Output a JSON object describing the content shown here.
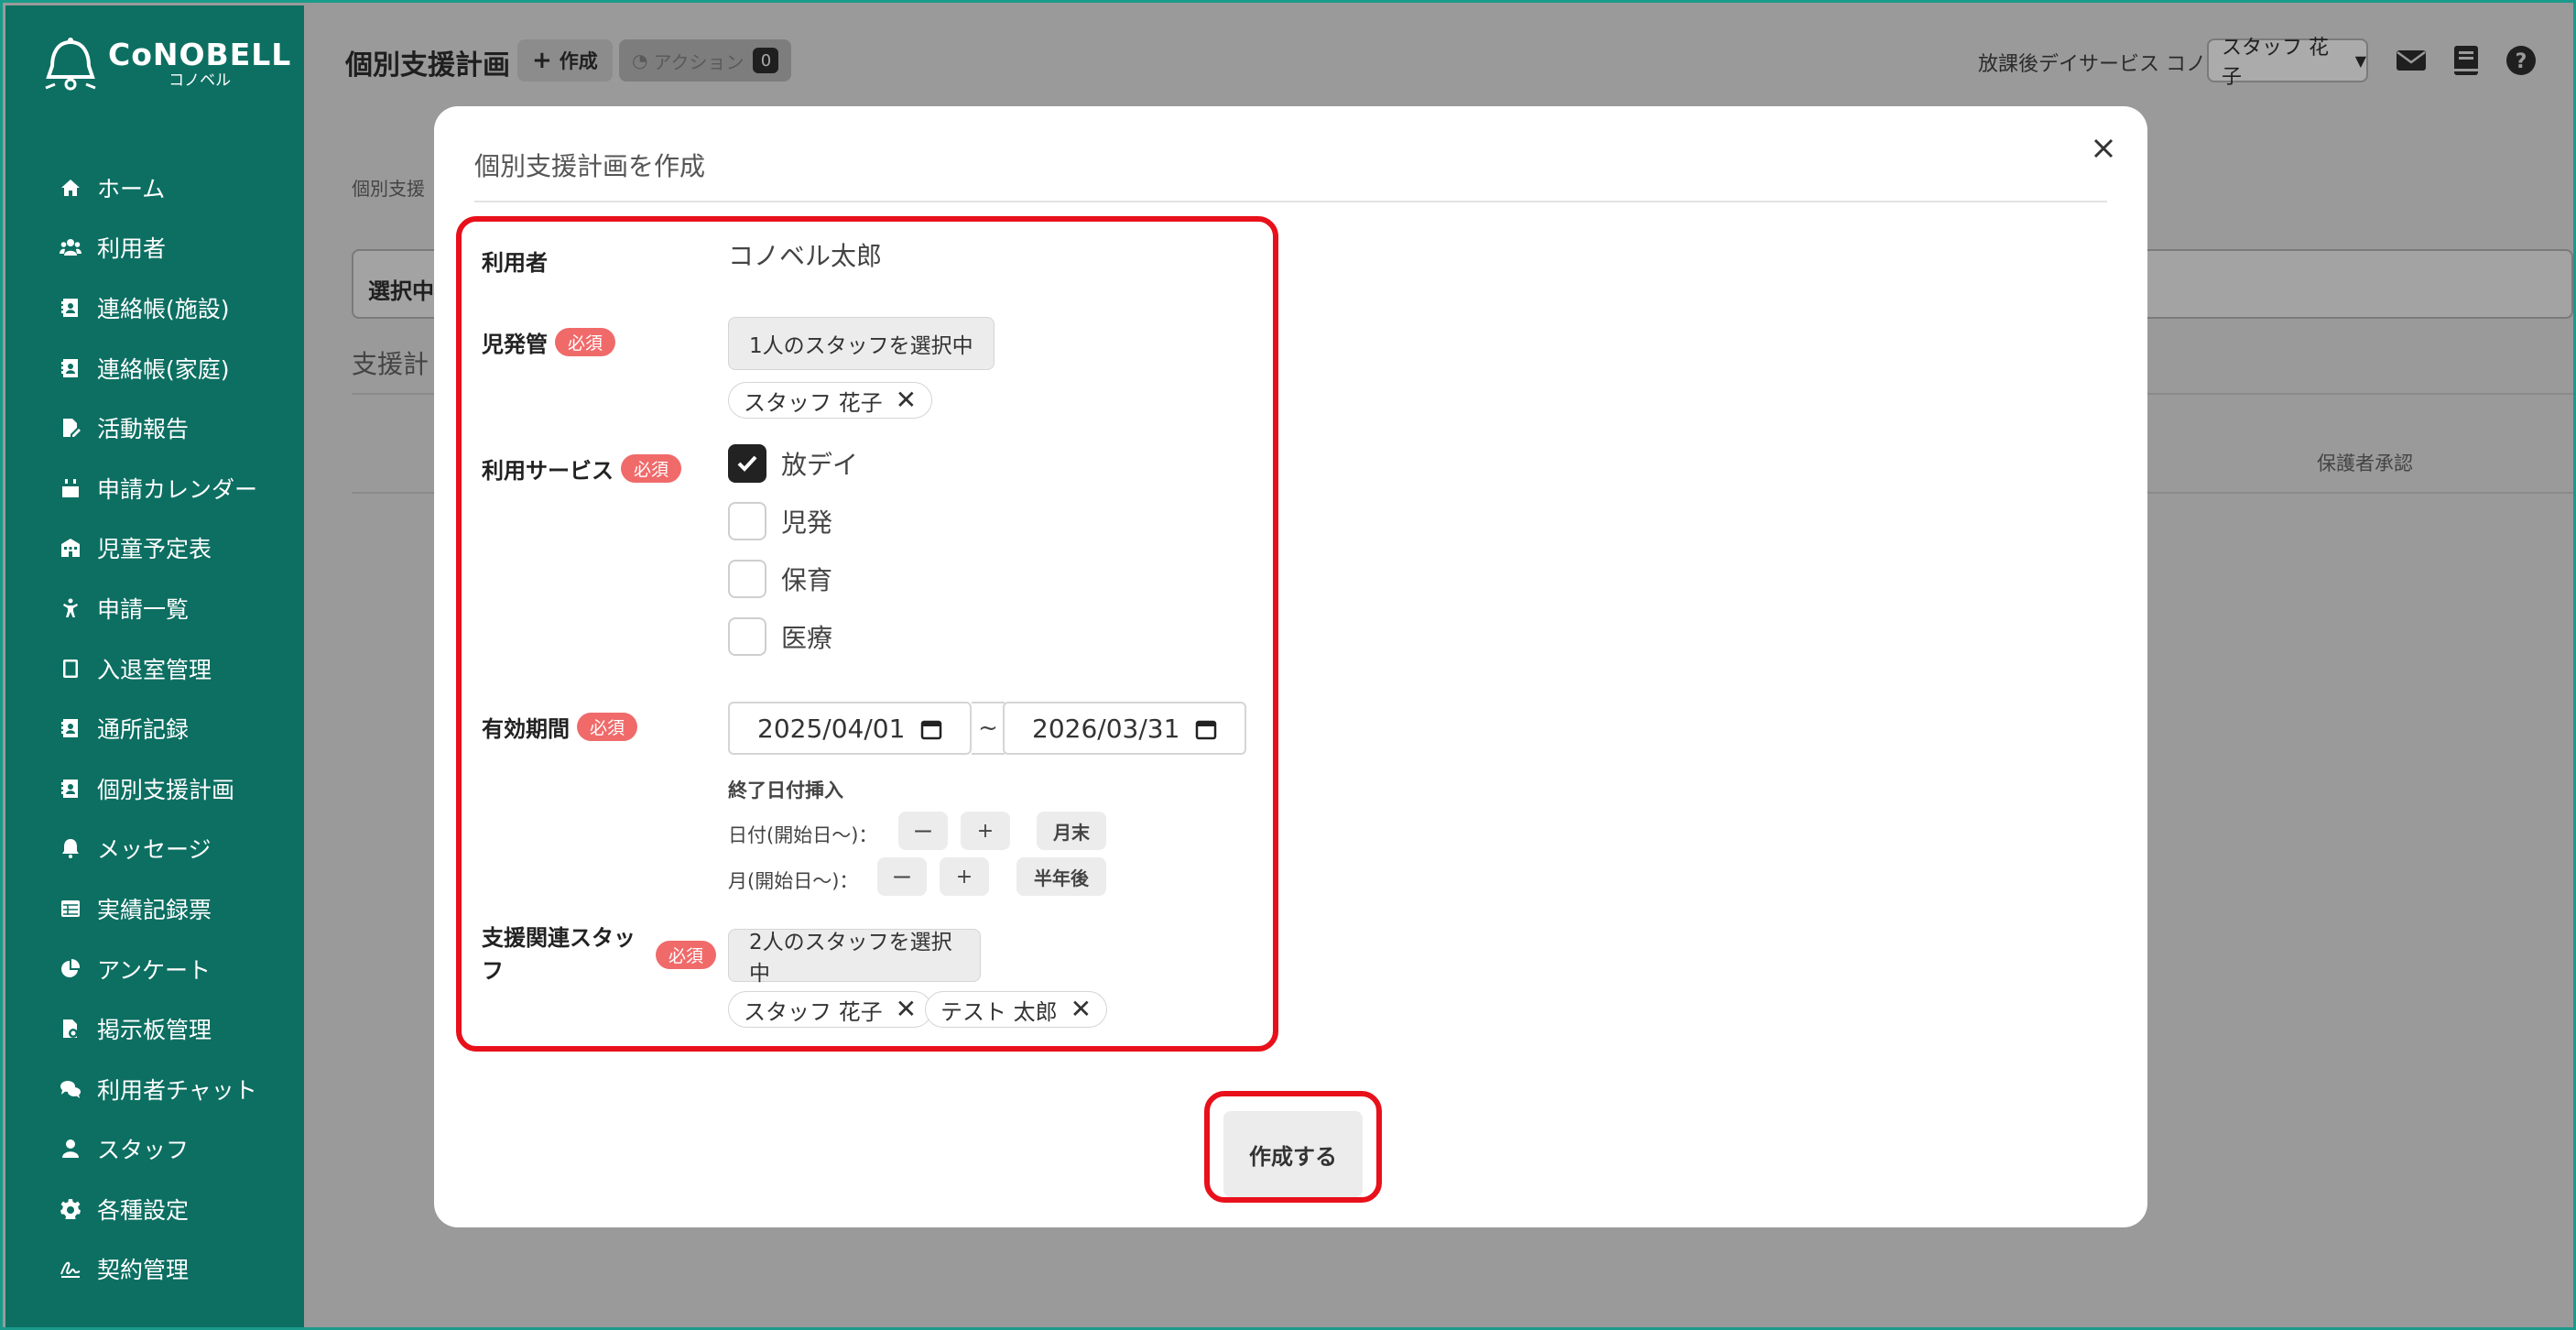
{
  "app": {
    "logo_main": "CoNOBELL",
    "logo_sub": "コノベル"
  },
  "sidebar": {
    "items": [
      {
        "label": "ホーム",
        "icon": "home-icon"
      },
      {
        "label": "利用者",
        "icon": "users-icon"
      },
      {
        "label": "連絡帳(施設)",
        "icon": "contact-book-icon"
      },
      {
        "label": "連絡帳(家庭)",
        "icon": "contact-book-icon"
      },
      {
        "label": "活動報告",
        "icon": "edit-document-icon"
      },
      {
        "label": "申請カレンダー",
        "icon": "calendar-icon"
      },
      {
        "label": "児童予定表",
        "icon": "building-icon"
      },
      {
        "label": "申請一覧",
        "icon": "child-icon"
      },
      {
        "label": "入退室管理",
        "icon": "tablet-icon"
      },
      {
        "label": "通所記録",
        "icon": "contact-book-icon"
      },
      {
        "label": "個別支援計画",
        "icon": "contact-book-icon"
      },
      {
        "label": "メッセージ",
        "icon": "bell-icon"
      },
      {
        "label": "実績記録票",
        "icon": "table-icon"
      },
      {
        "label": "アンケート",
        "icon": "pie-chart-icon"
      },
      {
        "label": "掲示板管理",
        "icon": "file-settings-icon"
      },
      {
        "label": "利用者チャット",
        "icon": "chat-icon"
      },
      {
        "label": "スタッフ",
        "icon": "person-icon"
      },
      {
        "label": "各種設定",
        "icon": "gear-icon"
      },
      {
        "label": "契約管理",
        "icon": "signature-icon"
      }
    ]
  },
  "header": {
    "title": "個別支援計画",
    "create_label": "作成",
    "action_label": "アクション",
    "action_count": "0",
    "facility": "放課後デイサービス コノベル",
    "staff_select": "スタッフ 花子"
  },
  "background": {
    "breadcrumb": "個別支援",
    "select_text": "選択中",
    "section_text": "支援計",
    "column_header": "保護者承認"
  },
  "modal": {
    "title": "個別支援計画を作成",
    "required_badge": "必須",
    "user_label": "利用者",
    "user_value": "コノベル太郎",
    "manager_label": "児発管",
    "manager_button": "1人のスタッフを選択中",
    "manager_tags": [
      "スタッフ 花子"
    ],
    "service_label": "利用サービス",
    "services": [
      {
        "label": "放デイ",
        "checked": true
      },
      {
        "label": "児発",
        "checked": false
      },
      {
        "label": "保育",
        "checked": false
      },
      {
        "label": "医療",
        "checked": false
      }
    ],
    "period_label": "有効期間",
    "start_date": "2025/04/01",
    "end_date": "2026/03/31",
    "period_separator": "~",
    "end_insert_label": "終了日付挿入",
    "day_row_label": "日付(開始日～)：",
    "month_row_label": "月(開始日～)：",
    "minus": "ー",
    "plus": "+",
    "month_end_button": "月末",
    "half_year_button": "半年後",
    "staff_label_line1": "支援関連スタッ",
    "staff_label_line2": "フ",
    "staff_button": "2人のスタッフを選択中",
    "staff_tags": [
      "スタッフ 花子",
      "テスト 太郎"
    ],
    "submit_label": "作成する"
  },
  "colors": {
    "sidebar": "#0c6f62",
    "highlight": "#e8101a",
    "required": "#f06a6a"
  }
}
